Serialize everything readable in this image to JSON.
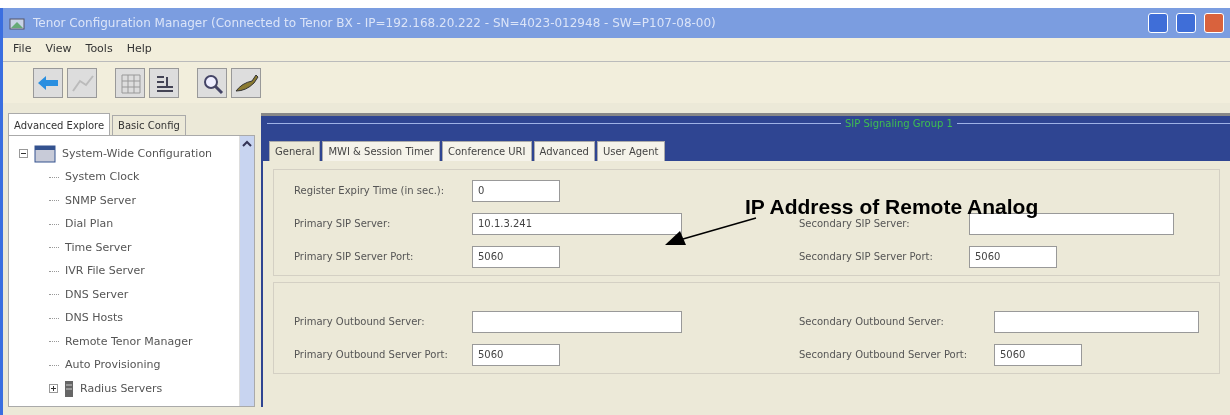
{
  "window": {
    "title": "Tenor Configuration Manager (Connected to Tenor BX - IP=192.168.20.222 - SN=4023-012948 - SW=P107-08-00)"
  },
  "menu": [
    "File",
    "View",
    "Tools",
    "Help"
  ],
  "nav_tabs": [
    {
      "label": "Advanced Explore",
      "selected": true
    },
    {
      "label": "Basic Config",
      "selected": false
    }
  ],
  "tree": [
    {
      "label": "System-Wide Configuration",
      "expanded": true,
      "children": [
        {
          "label": "System Clock"
        },
        {
          "label": "SNMP Server"
        },
        {
          "label": "Dial Plan"
        },
        {
          "label": "Time Server"
        },
        {
          "label": "IVR File Server"
        },
        {
          "label": "DNS Server"
        },
        {
          "label": "DNS Hosts"
        },
        {
          "label": "Remote Tenor Manager"
        },
        {
          "label": "Auto Provisioning"
        },
        {
          "label": "Radius Servers",
          "expanded": false
        }
      ]
    }
  ],
  "panel": {
    "title": "SIP Signaling Group 1",
    "tabs": [
      {
        "label": "General",
        "selected": true
      },
      {
        "label": "MWI & Session Timer",
        "selected": false
      },
      {
        "label": "Conference URI",
        "selected": false
      },
      {
        "label": "Advanced",
        "selected": false
      },
      {
        "label": "User Agent",
        "selected": false
      }
    ],
    "groups": [
      {
        "rows": [
          [
            {
              "label": "Register Expiry Time (in sec.):",
              "value": "0",
              "kind": "number"
            }
          ],
          [
            {
              "label": "Primary SIP Server:",
              "value": "10.1.3.241",
              "kind": "text"
            },
            {
              "label": "Secondary SIP Server:",
              "kind": "text"
            }
          ],
          [
            {
              "label": "Primary SIP Server Port:",
              "value": "5060",
              "kind": "number"
            },
            {
              "label": "Secondary SIP Server Port:",
              "value": "5060",
              "kind": "number"
            }
          ]
        ]
      },
      {
        "rows": [
          [
            {
              "label": "Primary Outbound Server:",
              "kind": "text"
            },
            {
              "label": "Secondary Outbound Server:",
              "kind": "text"
            }
          ],
          [
            {
              "label": "Primary Outbound Server Port:",
              "value": "5060",
              "kind": "number"
            },
            {
              "label": "Secondary Outbound Server Port:",
              "value": "5060",
              "kind": "number"
            }
          ]
        ]
      }
    ]
  },
  "annotation": {
    "text": "IP Address of Remote Analog"
  }
}
